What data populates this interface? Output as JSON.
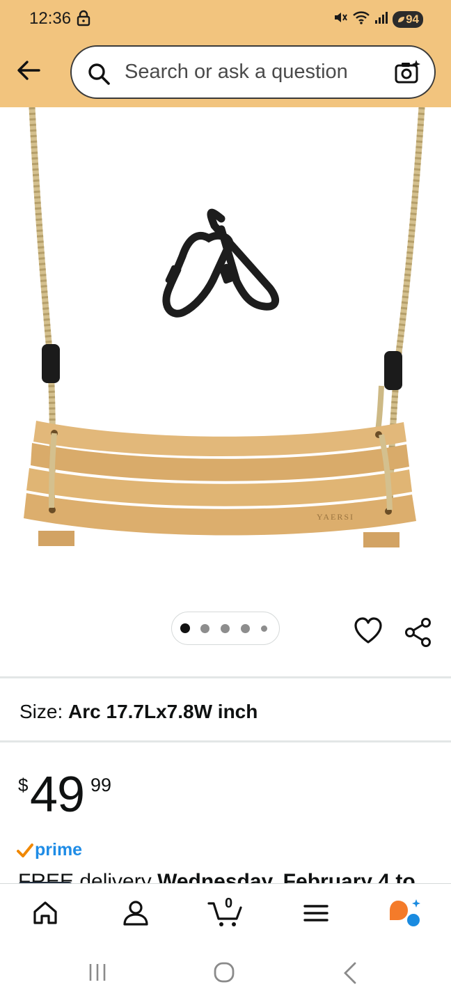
{
  "status_bar": {
    "time": "12:36",
    "battery": "94"
  },
  "search": {
    "placeholder": "Search or ask a question"
  },
  "product": {
    "image_alt": "Wooden tree swing with ropes and carabiners",
    "brand_on_seat": "YAERSI",
    "image_count": 5,
    "active_image_index": 0
  },
  "size": {
    "label": "Size:",
    "value": "Arc 17.7Lx7.8W inch"
  },
  "price": {
    "currency": "$",
    "whole": "49",
    "fraction": "99"
  },
  "prime": {
    "label": "prime"
  },
  "delivery": {
    "prefix": "FREE delivery",
    "date": "Wednesday, February 4 to"
  },
  "bottom_nav": {
    "cart_count": "0"
  },
  "colors": {
    "header_bg": "#f2c47e",
    "prime_blue": "#1f8ce6",
    "prime_check": "#f08804"
  }
}
